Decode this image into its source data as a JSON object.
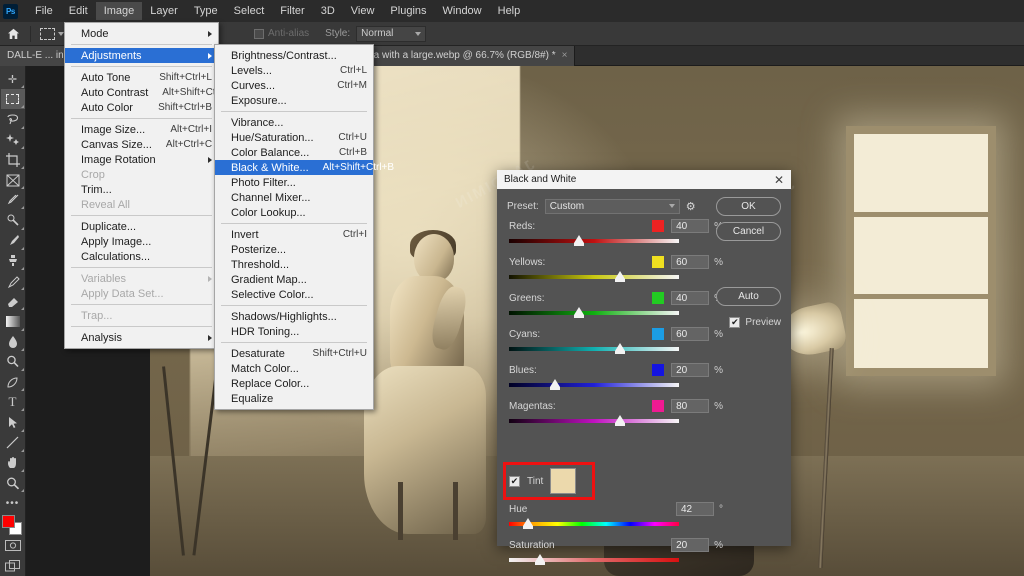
{
  "app": {
    "logo_text": "Ps",
    "menus": [
      "File",
      "Edit",
      "Image",
      "Layer",
      "Type",
      "Select",
      "Filter",
      "3D",
      "View",
      "Plugins",
      "Window",
      "Help"
    ],
    "active_menu": "Image"
  },
  "options_bar": {
    "home_icon": "home-icon",
    "tool_icon": "rectangular-marquee-icon",
    "antialias_label": "Anti-alias",
    "style_label": "Style:",
    "style_value": "Normal"
  },
  "document_tab": {
    "title": "DALL-E ... ing a portrait session. The photographer is holding a professional camera with a large.webp @ 66.7% (RGB/8#) *",
    "zoom": "66.7%",
    "color_mode": "RGB/8#",
    "close_label": "×"
  },
  "toolbar": {
    "tools": [
      {
        "name": "move-tool",
        "glyph": "✛"
      },
      {
        "name": "rectangular-marquee-tool",
        "glyph": "▭",
        "selected": true
      },
      {
        "name": "lasso-tool",
        "glyph": "⌁"
      },
      {
        "name": "object-selection-tool",
        "glyph": "✦"
      },
      {
        "name": "crop-tool",
        "glyph": "⌗"
      },
      {
        "name": "frame-tool",
        "glyph": "⊠"
      },
      {
        "name": "eyedropper-tool",
        "glyph": "⚲"
      },
      {
        "name": "spot-healing-brush-tool",
        "glyph": "✎"
      },
      {
        "name": "brush-tool",
        "glyph": "🖌"
      },
      {
        "name": "clone-stamp-tool",
        "glyph": "⎙"
      },
      {
        "name": "history-brush-tool",
        "glyph": "✐"
      },
      {
        "name": "eraser-tool",
        "glyph": "◣"
      },
      {
        "name": "gradient-tool",
        "glyph": "▤"
      },
      {
        "name": "blur-tool",
        "glyph": "💧"
      },
      {
        "name": "dodge-tool",
        "glyph": "🔍"
      },
      {
        "name": "pen-tool",
        "glyph": "✒"
      },
      {
        "name": "type-tool",
        "glyph": "T"
      },
      {
        "name": "path-selection-tool",
        "glyph": "➤"
      },
      {
        "name": "line-shape-tool",
        "glyph": "╱"
      },
      {
        "name": "hand-tool",
        "glyph": "✋"
      },
      {
        "name": "zoom-tool",
        "glyph": "🔍"
      },
      {
        "name": "edit-toolbar-tool",
        "glyph": "•••"
      }
    ],
    "foreground_color": "#ff0000",
    "background_color": "#ffffff"
  },
  "image_menu": {
    "items": [
      {
        "label": "Mode",
        "key": "",
        "submenu": true,
        "highlighted": false,
        "disabled": false
      },
      {
        "sep": true
      },
      {
        "label": "Adjustments",
        "key": "",
        "submenu": true,
        "highlighted": true,
        "disabled": false
      },
      {
        "sep": true
      },
      {
        "label": "Auto Tone",
        "key": "Shift+Ctrl+L"
      },
      {
        "label": "Auto Contrast",
        "key": "Alt+Shift+Ctrl+L"
      },
      {
        "label": "Auto Color",
        "key": "Shift+Ctrl+B"
      },
      {
        "sep": true
      },
      {
        "label": "Image Size...",
        "key": "Alt+Ctrl+I"
      },
      {
        "label": "Canvas Size...",
        "key": "Alt+Ctrl+C"
      },
      {
        "label": "Image Rotation",
        "key": "",
        "submenu": true
      },
      {
        "label": "Crop",
        "key": "",
        "disabled": true
      },
      {
        "label": "Trim...",
        "key": ""
      },
      {
        "label": "Reveal All",
        "key": "",
        "disabled": true
      },
      {
        "sep": true
      },
      {
        "label": "Duplicate...",
        "key": ""
      },
      {
        "label": "Apply Image...",
        "key": ""
      },
      {
        "label": "Calculations...",
        "key": ""
      },
      {
        "sep": true
      },
      {
        "label": "Variables",
        "key": "",
        "submenu": true,
        "disabled": true
      },
      {
        "label": "Apply Data Set...",
        "key": "",
        "disabled": true
      },
      {
        "sep": true
      },
      {
        "label": "Trap...",
        "key": "",
        "disabled": true
      },
      {
        "sep": true
      },
      {
        "label": "Analysis",
        "key": "",
        "submenu": true
      }
    ]
  },
  "adjustments_menu": {
    "items": [
      {
        "label": "Brightness/Contrast...",
        "key": ""
      },
      {
        "label": "Levels...",
        "key": "Ctrl+L"
      },
      {
        "label": "Curves...",
        "key": "Ctrl+M"
      },
      {
        "label": "Exposure...",
        "key": ""
      },
      {
        "sep": true
      },
      {
        "label": "Vibrance...",
        "key": ""
      },
      {
        "label": "Hue/Saturation...",
        "key": "Ctrl+U"
      },
      {
        "label": "Color Balance...",
        "key": "Ctrl+B"
      },
      {
        "label": "Black & White...",
        "key": "Alt+Shift+Ctrl+B",
        "highlighted": true
      },
      {
        "label": "Photo Filter...",
        "key": ""
      },
      {
        "label": "Channel Mixer...",
        "key": ""
      },
      {
        "label": "Color Lookup...",
        "key": ""
      },
      {
        "sep": true
      },
      {
        "label": "Invert",
        "key": "Ctrl+I"
      },
      {
        "label": "Posterize...",
        "key": ""
      },
      {
        "label": "Threshold...",
        "key": ""
      },
      {
        "label": "Gradient Map...",
        "key": ""
      },
      {
        "label": "Selective Color...",
        "key": ""
      },
      {
        "sep": true
      },
      {
        "label": "Shadows/Highlights...",
        "key": ""
      },
      {
        "label": "HDR Toning...",
        "key": ""
      },
      {
        "sep": true
      },
      {
        "label": "Desaturate",
        "key": "Shift+Ctrl+U"
      },
      {
        "label": "Match Color...",
        "key": ""
      },
      {
        "label": "Replace Color...",
        "key": ""
      },
      {
        "label": "Equalize",
        "key": ""
      }
    ]
  },
  "dialog": {
    "title": "Black and White",
    "close_label": "✕",
    "preset_label": "Preset:",
    "preset_value": "Custom",
    "gear_icon": "gear-icon",
    "buttons": {
      "ok": "OK",
      "cancel": "Cancel",
      "auto": "Auto"
    },
    "preview_label": "Preview",
    "preview_checked": true,
    "channels": [
      {
        "name": "Reds:",
        "value": "40",
        "unit": "%",
        "chip": "#ee2222",
        "pos_pct": 41
      },
      {
        "name": "Yellows:",
        "value": "60",
        "unit": "%",
        "chip": "#f0e020",
        "pos_pct": 65
      },
      {
        "name": "Greens:",
        "value": "40",
        "unit": "%",
        "chip": "#22cc22",
        "pos_pct": 41
      },
      {
        "name": "Cyans:",
        "value": "60",
        "unit": "%",
        "chip": "#1b9de4",
        "pos_pct": 65
      },
      {
        "name": "Blues:",
        "value": "20",
        "unit": "%",
        "chip": "#1414e0",
        "pos_pct": 27
      },
      {
        "name": "Magentas:",
        "value": "80",
        "unit": "%",
        "chip": "#f01a92",
        "pos_pct": 65
      }
    ],
    "tint": {
      "label": "Tint",
      "checked": true,
      "swatch_color": "#ecd9ac",
      "highlight_color": "#ee1111"
    },
    "hue": {
      "label": "Hue",
      "value": "42",
      "unit": "°",
      "pos_pct": 11
    },
    "saturation": {
      "label": "Saturation",
      "value": "20",
      "unit": "%",
      "pos_pct": 18
    }
  },
  "canvas": {
    "watermark_text": "JARDIMIN",
    "description": "Sepia-toned photo studio scene: seated woman on a stool in front of a backdrop, studio lamp and window at right"
  }
}
